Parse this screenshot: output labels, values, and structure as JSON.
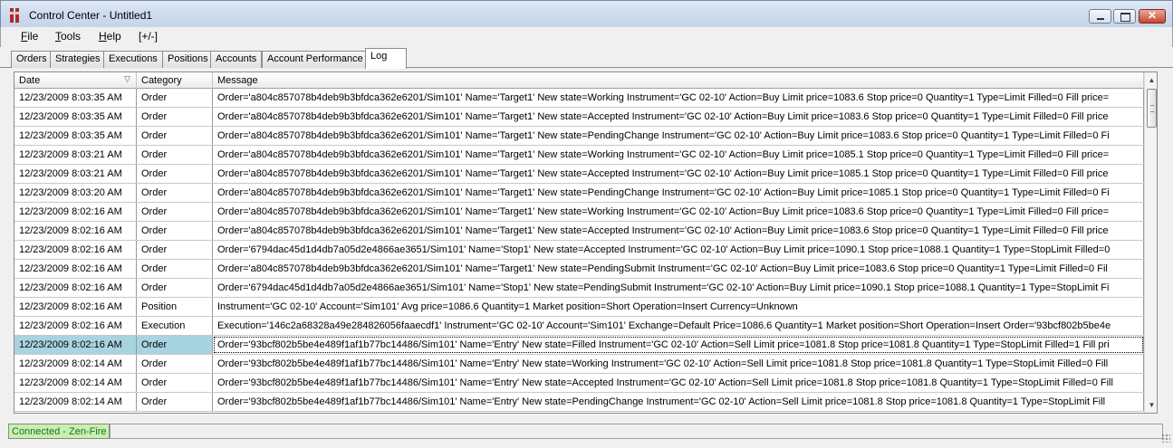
{
  "window": {
    "title": "Control Center - Untitled1"
  },
  "menu": {
    "file": "File",
    "tools": "Tools",
    "help": "Help",
    "toggle": "[+/-]"
  },
  "tabs": [
    {
      "label": "Orders"
    },
    {
      "label": "Strategies"
    },
    {
      "label": "Executions"
    },
    {
      "label": "Positions"
    },
    {
      "label": "Accounts"
    },
    {
      "label": "Account Performance"
    },
    {
      "label": "Log",
      "active": true
    }
  ],
  "grid": {
    "columns": {
      "date": "Date",
      "category": "Category",
      "message": "Message"
    },
    "rows": [
      {
        "date": "12/23/2009 8:03:35 AM",
        "category": "Order",
        "message": "Order='a804c857078b4deb9b3bfdca362e6201/Sim101' Name='Target1' New state=Working Instrument='GC 02-10' Action=Buy Limit price=1083.6 Stop price=0 Quantity=1 Type=Limit Filled=0 Fill price="
      },
      {
        "date": "12/23/2009 8:03:35 AM",
        "category": "Order",
        "message": "Order='a804c857078b4deb9b3bfdca362e6201/Sim101' Name='Target1' New state=Accepted Instrument='GC 02-10' Action=Buy Limit price=1083.6 Stop price=0 Quantity=1 Type=Limit Filled=0 Fill price"
      },
      {
        "date": "12/23/2009 8:03:35 AM",
        "category": "Order",
        "message": "Order='a804c857078b4deb9b3bfdca362e6201/Sim101' Name='Target1' New state=PendingChange Instrument='GC 02-10' Action=Buy Limit price=1083.6 Stop price=0 Quantity=1 Type=Limit Filled=0 Fi"
      },
      {
        "date": "12/23/2009 8:03:21 AM",
        "category": "Order",
        "message": "Order='a804c857078b4deb9b3bfdca362e6201/Sim101' Name='Target1' New state=Working Instrument='GC 02-10' Action=Buy Limit price=1085.1 Stop price=0 Quantity=1 Type=Limit Filled=0 Fill price="
      },
      {
        "date": "12/23/2009 8:03:21 AM",
        "category": "Order",
        "message": "Order='a804c857078b4deb9b3bfdca362e6201/Sim101' Name='Target1' New state=Accepted Instrument='GC 02-10' Action=Buy Limit price=1085.1 Stop price=0 Quantity=1 Type=Limit Filled=0 Fill price"
      },
      {
        "date": "12/23/2009 8:03:20 AM",
        "category": "Order",
        "message": "Order='a804c857078b4deb9b3bfdca362e6201/Sim101' Name='Target1' New state=PendingChange Instrument='GC 02-10' Action=Buy Limit price=1085.1 Stop price=0 Quantity=1 Type=Limit Filled=0 Fi"
      },
      {
        "date": "12/23/2009 8:02:16 AM",
        "category": "Order",
        "message": "Order='a804c857078b4deb9b3bfdca362e6201/Sim101' Name='Target1' New state=Working Instrument='GC 02-10' Action=Buy Limit price=1083.6 Stop price=0 Quantity=1 Type=Limit Filled=0 Fill price="
      },
      {
        "date": "12/23/2009 8:02:16 AM",
        "category": "Order",
        "message": "Order='a804c857078b4deb9b3bfdca362e6201/Sim101' Name='Target1' New state=Accepted Instrument='GC 02-10' Action=Buy Limit price=1083.6 Stop price=0 Quantity=1 Type=Limit Filled=0 Fill price"
      },
      {
        "date": "12/23/2009 8:02:16 AM",
        "category": "Order",
        "message": "Order='6794dac45d1d4db7a05d2e4866ae3651/Sim101' Name='Stop1' New state=Accepted Instrument='GC 02-10' Action=Buy Limit price=1090.1 Stop price=1088.1 Quantity=1 Type=StopLimit Filled=0"
      },
      {
        "date": "12/23/2009 8:02:16 AM",
        "category": "Order",
        "message": "Order='a804c857078b4deb9b3bfdca362e6201/Sim101' Name='Target1' New state=PendingSubmit Instrument='GC 02-10' Action=Buy Limit price=1083.6 Stop price=0 Quantity=1 Type=Limit Filled=0 Fil"
      },
      {
        "date": "12/23/2009 8:02:16 AM",
        "category": "Order",
        "message": "Order='6794dac45d1d4db7a05d2e4866ae3651/Sim101' Name='Stop1' New state=PendingSubmit Instrument='GC 02-10' Action=Buy Limit price=1090.1 Stop price=1088.1 Quantity=1 Type=StopLimit Fi"
      },
      {
        "date": "12/23/2009 8:02:16 AM",
        "category": "Position",
        "message": "Instrument='GC 02-10' Account='Sim101' Avg price=1086.6 Quantity=1 Market position=Short Operation=Insert Currency=Unknown"
      },
      {
        "date": "12/23/2009 8:02:16 AM",
        "category": "Execution",
        "message": "Execution='146c2a68328a49e284826056faaecdf1' Instrument='GC 02-10' Account='Sim101' Exchange=Default Price=1086.6 Quantity=1 Market position=Short Operation=Insert Order='93bcf802b5be4e"
      },
      {
        "date": "12/23/2009 8:02:16 AM",
        "category": "Order",
        "selected": true,
        "message": "Order='93bcf802b5be4e489f1af1b77bc14486/Sim101' Name='Entry' New state=Filled Instrument='GC 02-10' Action=Sell Limit price=1081.8 Stop price=1081.8 Quantity=1 Type=StopLimit Filled=1 Fill pri"
      },
      {
        "date": "12/23/2009 8:02:14 AM",
        "category": "Order",
        "message": "Order='93bcf802b5be4e489f1af1b77bc14486/Sim101' Name='Entry' New state=Working Instrument='GC 02-10' Action=Sell Limit price=1081.8 Stop price=1081.8 Quantity=1 Type=StopLimit Filled=0 Fill"
      },
      {
        "date": "12/23/2009 8:02:14 AM",
        "category": "Order",
        "message": "Order='93bcf802b5be4e489f1af1b77bc14486/Sim101' Name='Entry' New state=Accepted Instrument='GC 02-10' Action=Sell Limit price=1081.8 Stop price=1081.8 Quantity=1 Type=StopLimit Filled=0 Fill"
      },
      {
        "date": "12/23/2009 8:02:14 AM",
        "category": "Order",
        "message": "Order='93bcf802b5be4e489f1af1b77bc14486/Sim101' Name='Entry' New state=PendingChange Instrument='GC 02-10' Action=Sell Limit price=1081.8 Stop price=1081.8 Quantity=1 Type=StopLimit Fill"
      }
    ]
  },
  "status": {
    "connection": "Connected - Zen-Fire",
    "connection_color": "#c8f0b0"
  }
}
